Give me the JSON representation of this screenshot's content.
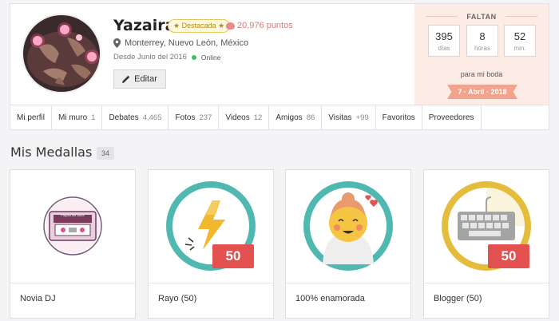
{
  "profile": {
    "name": "Yazaira",
    "badge": "★ Destacada ★",
    "points": "20,976 puntos",
    "location": "Monterrey, Nuevo León, México",
    "since": "Desde Junio del 2016",
    "status": "Online",
    "edit_label": "Editar"
  },
  "countdown": {
    "title": "FALTAN",
    "days": "395",
    "days_unit": "días",
    "hours": "8",
    "hours_unit": "horas",
    "minutes": "52",
    "minutes_unit": "min.",
    "subtitle": "para mi boda",
    "date": "7 · Abril · 2018"
  },
  "nav": {
    "items": [
      {
        "label": "Mi perfil",
        "count": ""
      },
      {
        "label": "Mi muro",
        "count": "1"
      },
      {
        "label": "Debates",
        "count": "4,465"
      },
      {
        "label": "Fotos",
        "count": "237"
      },
      {
        "label": "Videos",
        "count": "12"
      },
      {
        "label": "Amigos",
        "count": "86"
      },
      {
        "label": "Visitas",
        "count": "+99"
      },
      {
        "label": "Favoritos",
        "count": ""
      },
      {
        "label": "Proveedores",
        "count": ""
      }
    ]
  },
  "medals": {
    "title": "Mis Medallas",
    "count": "34",
    "items": [
      {
        "label": "Novia DJ",
        "image_text": "Playlist del Amor",
        "level": ""
      },
      {
        "label": "Rayo (50)",
        "level": "50"
      },
      {
        "label": "100% enamorada",
        "level": ""
      },
      {
        "label": "Blogger (50)",
        "level": "50"
      }
    ]
  },
  "colors": {
    "accent_pink": "#f2a38e",
    "teal": "#4fb8b0",
    "gold": "#e5bd3c",
    "level_red": "#e25050",
    "online_green": "#3cbf5c"
  }
}
